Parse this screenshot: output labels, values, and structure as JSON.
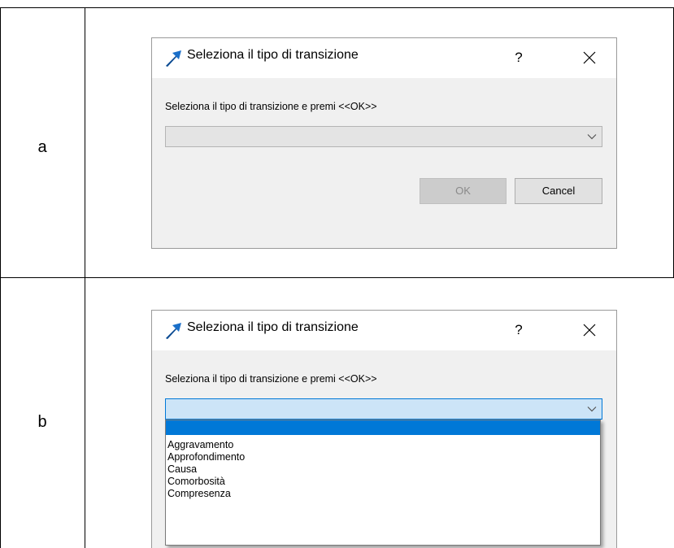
{
  "rows": [
    {
      "label": "a",
      "dialog": {
        "title": "Seleziona il tipo di transizione",
        "help_label": "?",
        "prompt": "Seleziona il tipo di transizione e premi <<OK>>",
        "combo_value": "",
        "ok_label": "OK",
        "cancel_label": "Cancel"
      }
    },
    {
      "label": "b",
      "dialog": {
        "title": "Seleziona il tipo di transizione",
        "help_label": "?",
        "prompt": "Seleziona il tipo di transizione e premi <<OK>>",
        "combo_value": "",
        "options": [
          "",
          "Aggravamento",
          "Approfondimento",
          "Causa",
          "Comorbosità",
          "Compresenza"
        ]
      }
    }
  ],
  "colors": {
    "accent": "#0078d7",
    "combo_open_bg": "#cce4f7",
    "dialog_bg": "#f0f0f0",
    "icon_blue": "#1a6fc9"
  },
  "icons": {
    "app": "arrow-up-right-icon",
    "close": "close-icon",
    "dropdown": "chevron-down-icon"
  }
}
